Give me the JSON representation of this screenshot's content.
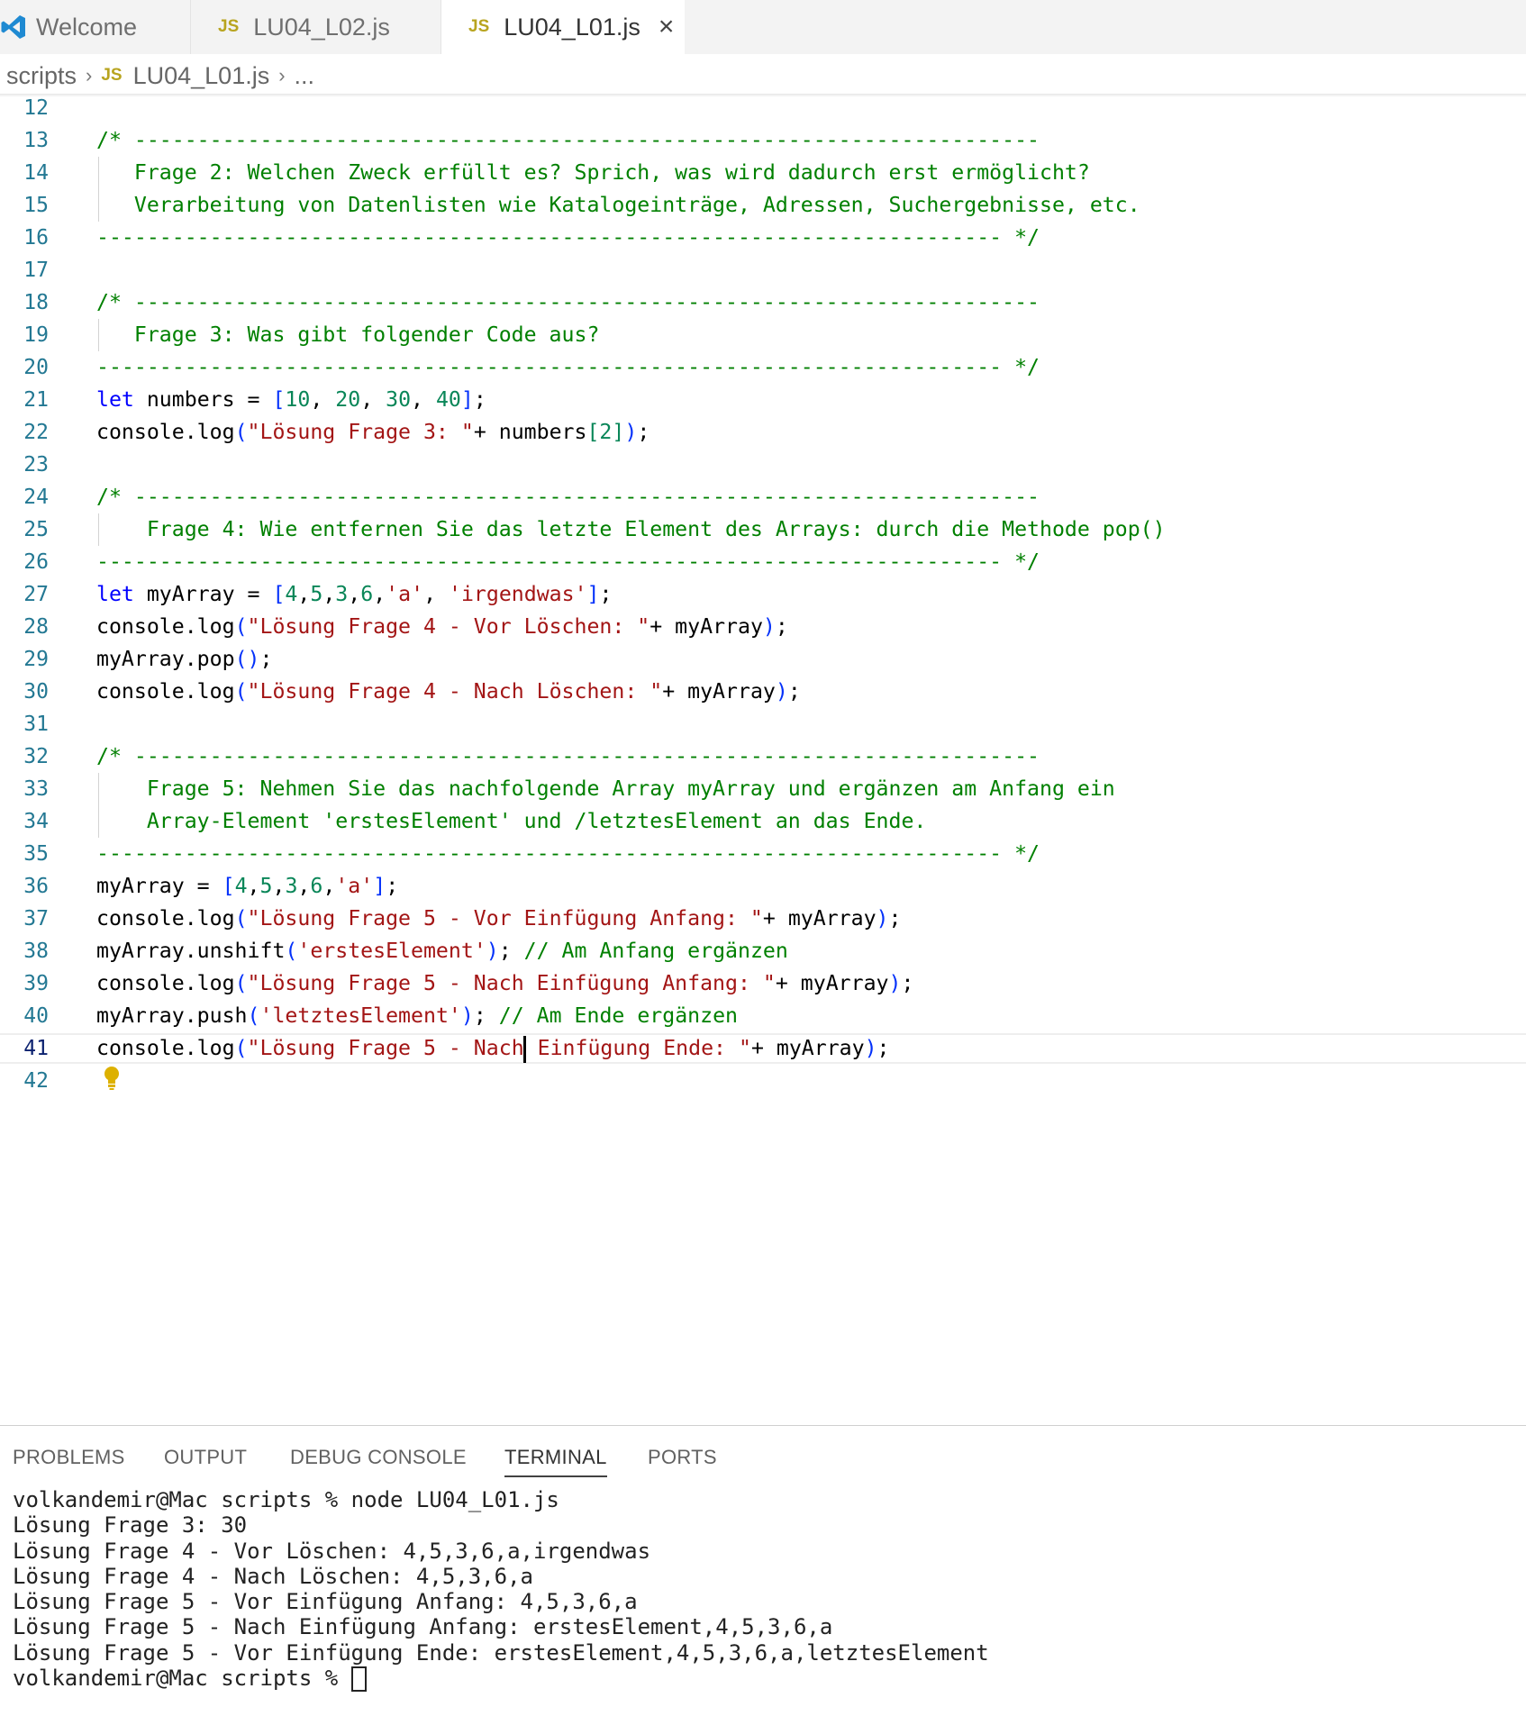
{
  "tabs": [
    {
      "label": "Welcome",
      "icon": "vscode-icon",
      "active": false
    },
    {
      "label": "LU04_L02.js",
      "icon": "js-icon",
      "active": false
    },
    {
      "label": "LU04_L01.js",
      "icon": "js-icon",
      "active": true
    }
  ],
  "js_badge": "JS",
  "breadcrumb": {
    "folder": "scripts",
    "file": "LU04_L01.js",
    "more": "..."
  },
  "editor": {
    "active_line": 41,
    "lines": [
      {
        "n": "12",
        "tokens": []
      },
      {
        "n": "13",
        "tokens": [
          {
            "t": "c",
            "v": "/* ------------------------------------------------------------------------"
          }
        ]
      },
      {
        "n": "14",
        "guide": true,
        "tokens": [
          {
            "t": "c",
            "v": "   Frage 2: Welchen Zweck erfüllt es? Sprich, was wird dadurch erst ermöglicht?"
          }
        ]
      },
      {
        "n": "15",
        "guide": true,
        "tokens": [
          {
            "t": "c",
            "v": "   Verarbeitung von Datenlisten wie Katalogeinträge, Adressen, Suchergebnisse, etc."
          }
        ]
      },
      {
        "n": "16",
        "tokens": [
          {
            "t": "c",
            "v": "------------------------------------------------------------------------ */"
          }
        ]
      },
      {
        "n": "17",
        "tokens": []
      },
      {
        "n": "18",
        "tokens": [
          {
            "t": "c",
            "v": "/* ------------------------------------------------------------------------"
          }
        ]
      },
      {
        "n": "19",
        "guide": true,
        "tokens": [
          {
            "t": "c",
            "v": "   Frage 3: Was gibt folgender Code aus?"
          }
        ]
      },
      {
        "n": "20",
        "tokens": [
          {
            "t": "c",
            "v": "------------------------------------------------------------------------ */"
          }
        ]
      },
      {
        "n": "21",
        "tokens": [
          {
            "t": "k",
            "v": "let"
          },
          {
            "t": "p",
            "v": " numbers = "
          },
          {
            "t": "b",
            "v": "["
          },
          {
            "t": "n",
            "v": "10"
          },
          {
            "t": "p",
            "v": ", "
          },
          {
            "t": "n",
            "v": "20"
          },
          {
            "t": "p",
            "v": ", "
          },
          {
            "t": "n",
            "v": "30"
          },
          {
            "t": "p",
            "v": ", "
          },
          {
            "t": "n",
            "v": "40"
          },
          {
            "t": "b",
            "v": "]"
          },
          {
            "t": "p",
            "v": ";"
          }
        ]
      },
      {
        "n": "22",
        "tokens": [
          {
            "t": "p",
            "v": "console.log"
          },
          {
            "t": "b",
            "v": "("
          },
          {
            "t": "s",
            "v": "\"Lösung Frage 3: \""
          },
          {
            "t": "p",
            "v": "+ numbers"
          },
          {
            "t": "n",
            "v": "[2]"
          },
          {
            "t": "b",
            "v": ")"
          },
          {
            "t": "p",
            "v": ";"
          }
        ]
      },
      {
        "n": "23",
        "tokens": []
      },
      {
        "n": "24",
        "tokens": [
          {
            "t": "c",
            "v": "/* ------------------------------------------------------------------------"
          }
        ]
      },
      {
        "n": "25",
        "guide": true,
        "tokens": [
          {
            "t": "c",
            "v": "    Frage 4: Wie entfernen Sie das letzte Element des Arrays: durch die Methode pop()"
          }
        ]
      },
      {
        "n": "26",
        "tokens": [
          {
            "t": "c",
            "v": "------------------------------------------------------------------------ */"
          }
        ]
      },
      {
        "n": "27",
        "tokens": [
          {
            "t": "k",
            "v": "let"
          },
          {
            "t": "p",
            "v": " myArray = "
          },
          {
            "t": "b",
            "v": "["
          },
          {
            "t": "n",
            "v": "4"
          },
          {
            "t": "p",
            "v": ","
          },
          {
            "t": "n",
            "v": "5"
          },
          {
            "t": "p",
            "v": ","
          },
          {
            "t": "n",
            "v": "3"
          },
          {
            "t": "p",
            "v": ","
          },
          {
            "t": "n",
            "v": "6"
          },
          {
            "t": "p",
            "v": ","
          },
          {
            "t": "s",
            "v": "'a'"
          },
          {
            "t": "p",
            "v": ", "
          },
          {
            "t": "s",
            "v": "'irgendwas'"
          },
          {
            "t": "b",
            "v": "]"
          },
          {
            "t": "p",
            "v": ";"
          }
        ]
      },
      {
        "n": "28",
        "tokens": [
          {
            "t": "p",
            "v": "console.log"
          },
          {
            "t": "b",
            "v": "("
          },
          {
            "t": "s",
            "v": "\"Lösung Frage 4 - Vor Löschen: \""
          },
          {
            "t": "p",
            "v": "+ myArray"
          },
          {
            "t": "b",
            "v": ")"
          },
          {
            "t": "p",
            "v": ";"
          }
        ]
      },
      {
        "n": "29",
        "tokens": [
          {
            "t": "p",
            "v": "myArray.pop"
          },
          {
            "t": "b",
            "v": "()"
          },
          {
            "t": "p",
            "v": ";"
          }
        ]
      },
      {
        "n": "30",
        "tokens": [
          {
            "t": "p",
            "v": "console.log"
          },
          {
            "t": "b",
            "v": "("
          },
          {
            "t": "s",
            "v": "\"Lösung Frage 4 - Nach Löschen: \""
          },
          {
            "t": "p",
            "v": "+ myArray"
          },
          {
            "t": "b",
            "v": ")"
          },
          {
            "t": "p",
            "v": ";"
          }
        ]
      },
      {
        "n": "31",
        "tokens": []
      },
      {
        "n": "32",
        "tokens": [
          {
            "t": "c",
            "v": "/* ------------------------------------------------------------------------"
          }
        ]
      },
      {
        "n": "33",
        "guide": true,
        "tokens": [
          {
            "t": "c",
            "v": "    Frage 5: Nehmen Sie das nachfolgende Array myArray und ergänzen am Anfang ein"
          }
        ]
      },
      {
        "n": "34",
        "guide": true,
        "tokens": [
          {
            "t": "c",
            "v": "    Array-Element 'erstesElement' und /letztesElement an das Ende."
          }
        ]
      },
      {
        "n": "35",
        "tokens": [
          {
            "t": "c",
            "v": "------------------------------------------------------------------------ */"
          }
        ]
      },
      {
        "n": "36",
        "tokens": [
          {
            "t": "p",
            "v": "myArray = "
          },
          {
            "t": "b",
            "v": "["
          },
          {
            "t": "n",
            "v": "4"
          },
          {
            "t": "p",
            "v": ","
          },
          {
            "t": "n",
            "v": "5"
          },
          {
            "t": "p",
            "v": ","
          },
          {
            "t": "n",
            "v": "3"
          },
          {
            "t": "p",
            "v": ","
          },
          {
            "t": "n",
            "v": "6"
          },
          {
            "t": "p",
            "v": ","
          },
          {
            "t": "s",
            "v": "'a'"
          },
          {
            "t": "b",
            "v": "]"
          },
          {
            "t": "p",
            "v": ";"
          }
        ]
      },
      {
        "n": "37",
        "tokens": [
          {
            "t": "p",
            "v": "console.log"
          },
          {
            "t": "b",
            "v": "("
          },
          {
            "t": "s",
            "v": "\"Lösung Frage 5 - Vor Einfügung Anfang: \""
          },
          {
            "t": "p",
            "v": "+ myArray"
          },
          {
            "t": "b",
            "v": ")"
          },
          {
            "t": "p",
            "v": ";"
          }
        ]
      },
      {
        "n": "38",
        "tokens": [
          {
            "t": "p",
            "v": "myArray.unshift"
          },
          {
            "t": "b",
            "v": "("
          },
          {
            "t": "s",
            "v": "'erstesElement'"
          },
          {
            "t": "b",
            "v": ")"
          },
          {
            "t": "p",
            "v": "; "
          },
          {
            "t": "c",
            "v": "// Am Anfang ergänzen"
          }
        ]
      },
      {
        "n": "39",
        "tokens": [
          {
            "t": "p",
            "v": "console.log"
          },
          {
            "t": "b",
            "v": "("
          },
          {
            "t": "s",
            "v": "\"Lösung Frage 5 - Nach Einfügung Anfang: \""
          },
          {
            "t": "p",
            "v": "+ myArray"
          },
          {
            "t": "b",
            "v": ")"
          },
          {
            "t": "p",
            "v": ";"
          }
        ]
      },
      {
        "n": "40",
        "tokens": [
          {
            "t": "p",
            "v": "myArray.push"
          },
          {
            "t": "b",
            "v": "("
          },
          {
            "t": "s",
            "v": "'letztesElement'"
          },
          {
            "t": "b",
            "v": ")"
          },
          {
            "t": "p",
            "v": "; "
          },
          {
            "t": "c",
            "v": "// Am Ende ergänzen"
          }
        ]
      },
      {
        "n": "41",
        "tokens": [
          {
            "t": "p",
            "v": "console.log"
          },
          {
            "t": "b",
            "v": "("
          },
          {
            "t": "s",
            "v": "\"Lösung Frage 5 - Nach"
          },
          {
            "t": "cursor",
            "v": ""
          },
          {
            "t": "s",
            "v": " Einfügung Ende: \""
          },
          {
            "t": "p",
            "v": "+ myArray"
          },
          {
            "t": "b",
            "v": ")"
          },
          {
            "t": "p",
            "v": ";"
          }
        ]
      },
      {
        "n": "42",
        "tokens": []
      }
    ]
  },
  "panel": {
    "tabs": [
      {
        "label": "PROBLEMS",
        "active": false
      },
      {
        "label": "OUTPUT",
        "active": false
      },
      {
        "label": "DEBUG CONSOLE",
        "active": false
      },
      {
        "label": "TERMINAL",
        "active": true
      },
      {
        "label": "PORTS",
        "active": false
      }
    ],
    "terminal_lines": [
      "volkandemir@Mac scripts % node LU04_L01.js",
      "Lösung Frage 3: 30",
      "Lösung Frage 4 - Vor Löschen: 4,5,3,6,a,irgendwas",
      "Lösung Frage 4 - Nach Löschen: 4,5,3,6,a",
      "Lösung Frage 5 - Vor Einfügung Anfang: 4,5,3,6,a",
      "Lösung Frage 5 - Nach Einfügung Anfang: erstesElement,4,5,3,6,a",
      "Lösung Frage 5 - Vor Einfügung Ende: erstesElement,4,5,3,6,a,letztesElement"
    ],
    "prompt": "volkandemir@Mac scripts % "
  },
  "colors": {
    "comment": "#008000",
    "keyword": "#0000ff",
    "string": "#a31515",
    "number": "#098658",
    "bracket": "#0431fa",
    "line_number": "#237893"
  }
}
